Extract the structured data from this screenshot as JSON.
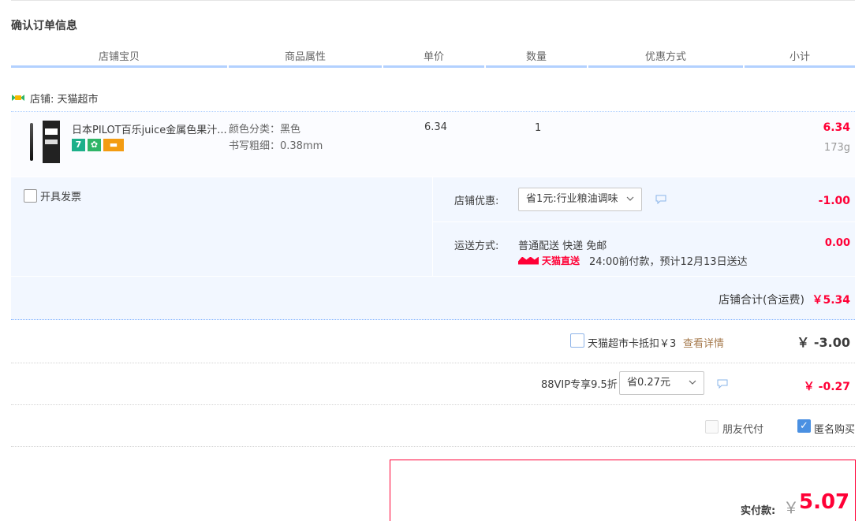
{
  "page_title": "确认订单信息",
  "columns": [
    "店铺宝贝",
    "商品属性",
    "单价",
    "数量",
    "优惠方式",
    "小计"
  ],
  "shop": {
    "name": "店铺: 天猫超市",
    "icon": "tmall-shop-icon"
  },
  "item": {
    "title": "日本PILOT百乐juice金属色果汁...",
    "badges": [
      "7",
      "✿",
      "▬"
    ],
    "attr_color": "颜色分类：黑色",
    "attr_size": "书写粗细：0.38mm",
    "price": "6.34",
    "quantity": "1",
    "subtotal": "6.34",
    "weight": "173g"
  },
  "invoice": {
    "label": "开具发票",
    "checked": false
  },
  "shop_coupon": {
    "label": "店铺优惠:",
    "selected": "省1元:行业粮油调味",
    "amount": "-1.00"
  },
  "shipping": {
    "label": "运送方式:",
    "method": "普通配送 快递 免邮",
    "logo_text": "天猫直送",
    "note": "24:00前付款，预计12月13日送达",
    "amount": "0.00"
  },
  "shop_total": {
    "label": "店铺合计(含运费)",
    "value": "￥5.34"
  },
  "card_deduct": {
    "label": "天猫超市卡抵扣￥3",
    "link": "查看详情",
    "amount": "￥ -3.00",
    "checked": false
  },
  "vip": {
    "label": "88VIP专享9.5折",
    "selected": "省0.27元",
    "amount": "￥ -0.27"
  },
  "pay_options": {
    "friend": "朋友代付",
    "friend_checked": false,
    "anonymous": "匿名购买",
    "anonymous_checked": true
  },
  "final": {
    "label": "实付款:",
    "currency": "￥",
    "value": "5.07"
  },
  "colors": {
    "accent": "#ff0036",
    "header_line": "#b2d1ff",
    "panel_bg": "#f2f7ff",
    "link": "#a67a4d"
  }
}
